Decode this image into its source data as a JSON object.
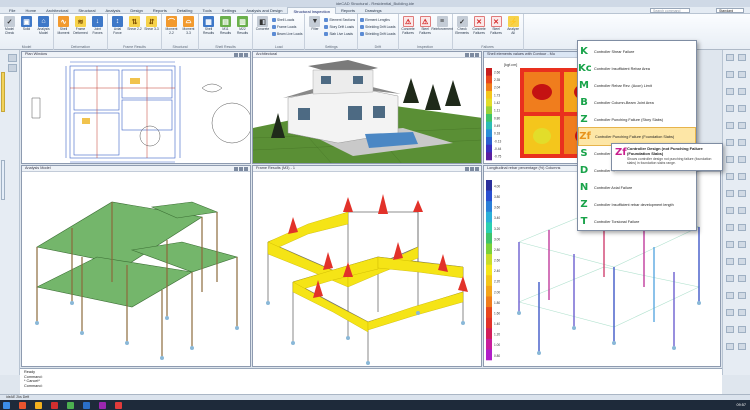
{
  "window": {
    "title": "ideCAD Structural  -  Residential_Building.ide"
  },
  "tabs": [
    "File",
    "Home",
    "Architectural",
    "Structural",
    "Analysis",
    "Design",
    "Reports",
    "Detailing",
    "Tools",
    "Settings",
    "Analysis and Design",
    "Structural Inspection",
    "Reports",
    "Drawings"
  ],
  "active_tab": "Structural Inspection",
  "search_placeholder": "Search command",
  "standard_value": "Standard",
  "ribbon": {
    "groups": [
      {
        "label": "Model",
        "buttons": [
          {
            "label": "Model Check",
            "icon": "check-icon",
            "glyph": "✓",
            "color": "gray"
          },
          {
            "label": "Solid",
            "icon": "cube-icon",
            "glyph": "▣",
            "color": "blue"
          },
          {
            "label": "Analysis Model",
            "icon": "frame-icon",
            "glyph": "⌂",
            "color": "blue"
          }
        ]
      },
      {
        "label": "Deformation",
        "buttons": [
          {
            "label": "Shell Moment",
            "icon": "moment-icon",
            "glyph": "∿",
            "color": "orange"
          },
          {
            "label": "Frame Deformed",
            "icon": "deform-icon",
            "glyph": "≋",
            "color": "yellow"
          },
          {
            "label": "Joint Forces",
            "icon": "arrow-icon",
            "glyph": "↓",
            "color": "blue"
          }
        ]
      },
      {
        "label": "Frame Results",
        "buttons": [
          {
            "label": "Axial Force",
            "icon": "axial-icon",
            "glyph": "↕",
            "color": "blue"
          },
          {
            "label": "Shear 2-2",
            "icon": "shear-icon",
            "glyph": "⇅",
            "color": "yellow"
          },
          {
            "label": "Shear 3-3",
            "icon": "shear-icon",
            "glyph": "⇵",
            "color": "yellow"
          }
        ]
      },
      {
        "label": "Structural",
        "buttons": [
          {
            "label": "Moment 2-2",
            "icon": "moment-icon",
            "glyph": "⌒",
            "color": "orange"
          },
          {
            "label": "Moment 3-3",
            "icon": "moment-icon",
            "glyph": "⌓",
            "color": "orange"
          }
        ]
      },
      {
        "label": "Shell Results",
        "buttons": [
          {
            "label": "Shell Results",
            "icon": "shell-icon",
            "glyph": "▦",
            "color": "blue"
          },
          {
            "label": "M11 Results",
            "icon": "shell-icon",
            "glyph": "▤",
            "color": "green"
          },
          {
            "label": "M22 Results",
            "icon": "shell-icon",
            "glyph": "▥",
            "color": "green"
          }
        ]
      },
      {
        "label": "Load",
        "buttons": [
          {
            "label": "Concrete",
            "icon": "concrete-icon",
            "glyph": "◧",
            "color": "gray"
          }
        ],
        "small": [
          "Shell Loads",
          "Frame Loads",
          "Beam Live Loads"
        ]
      },
      {
        "label": "Settings",
        "buttons": [
          {
            "label": "Filter",
            "icon": "filter-icon",
            "glyph": "▼",
            "color": "gray"
          }
        ],
        "small": [
          "Element Sections",
          "Story Drift Loads",
          "Slab Live Loads"
        ]
      },
      {
        "label": "Drift",
        "buttons": [],
        "small": [
          "Element Lengths",
          "Shielding Drift Loads",
          "Shielding Drift Loads"
        ]
      },
      {
        "label": "Inspection",
        "buttons": [
          {
            "label": "Concrete Failures",
            "icon": "warn-icon",
            "glyph": "⚠",
            "color": "red"
          },
          {
            "label": "Steel Failures",
            "icon": "warn-icon",
            "glyph": "⚠",
            "color": "red"
          },
          {
            "label": "Reinforcement",
            "icon": "bars-icon",
            "glyph": "≡",
            "color": "gray"
          }
        ]
      },
      {
        "label": "Failures",
        "buttons": [
          {
            "label": "Check Elements",
            "icon": "check-icon",
            "glyph": "✓",
            "color": "gray"
          },
          {
            "label": "Concrete Failures",
            "icon": "close-icon",
            "glyph": "✕",
            "color": "red"
          },
          {
            "label": "Steel Failures",
            "icon": "close-icon",
            "glyph": "✕",
            "color": "red"
          },
          {
            "label": "Analyze All",
            "icon": "lightning-icon",
            "glyph": "⚡",
            "color": "yellow"
          }
        ]
      }
    ]
  },
  "viewports": {
    "plan": "Plan Window",
    "render": "Architectural",
    "contour": "Shell elements values with Contour - Mu",
    "analysis": "Analysis Model",
    "frame": "Frame Results (M3) - 1",
    "longitudinal": "Longitudinal rebar percentage (%) Columns"
  },
  "contour_legend": [
    "2.66",
    "2.35",
    "2.04",
    "1.73",
    "1.42",
    "1.11",
    "0.80",
    "0.49",
    "0.18",
    "-0.13",
    "-0.44",
    "-0.75"
  ],
  "contour_units": "[kgf.cm]",
  "rebar_legend": [
    "4.00",
    "3.80",
    "3.60",
    "3.40",
    "3.20",
    "3.00",
    "2.80",
    "2.60",
    "2.40",
    "2.20",
    "2.00",
    "1.80",
    "1.60",
    "1.40",
    "1.20",
    "1.00",
    "0.80"
  ],
  "dropdown": {
    "items": [
      {
        "key": "K",
        "label": "Controller Shear Failure"
      },
      {
        "key": "Kc",
        "label": "Controller Insufficient Rebar Area"
      },
      {
        "key": "M",
        "label": "Controller Rebar Rev. (Acon) Limit"
      },
      {
        "key": "B",
        "label": "Controller Column-Beam Joint Area"
      },
      {
        "key": "Z",
        "label": "Controller Punching Failure (Story Slabs)"
      },
      {
        "key": "Zf",
        "label": "Controller Punching Failure (Foundation Slabs)"
      },
      {
        "key": "S",
        "label": "Controller ..."
      },
      {
        "key": "D",
        "label": "Controller ..."
      },
      {
        "key": "N",
        "label": "Controller Axial Failure"
      },
      {
        "key": "Z",
        "label": "Controller Insufficient rebar development length"
      },
      {
        "key": "T",
        "label": "Controller Torsional Failure"
      }
    ],
    "highlighted": 5
  },
  "tooltip": {
    "key": "Zf",
    "title": "Controller Design (not Punching Failure (Foundation Slabs)",
    "desc": "Shows controller design not punching failure (foundation slabs) in foundation slabs range."
  },
  "command_lines": [
    "Ready",
    "Command:",
    "* Cancel*",
    "Command:"
  ],
  "status": "ideAE 2ks Deft",
  "clock": "09:57"
}
